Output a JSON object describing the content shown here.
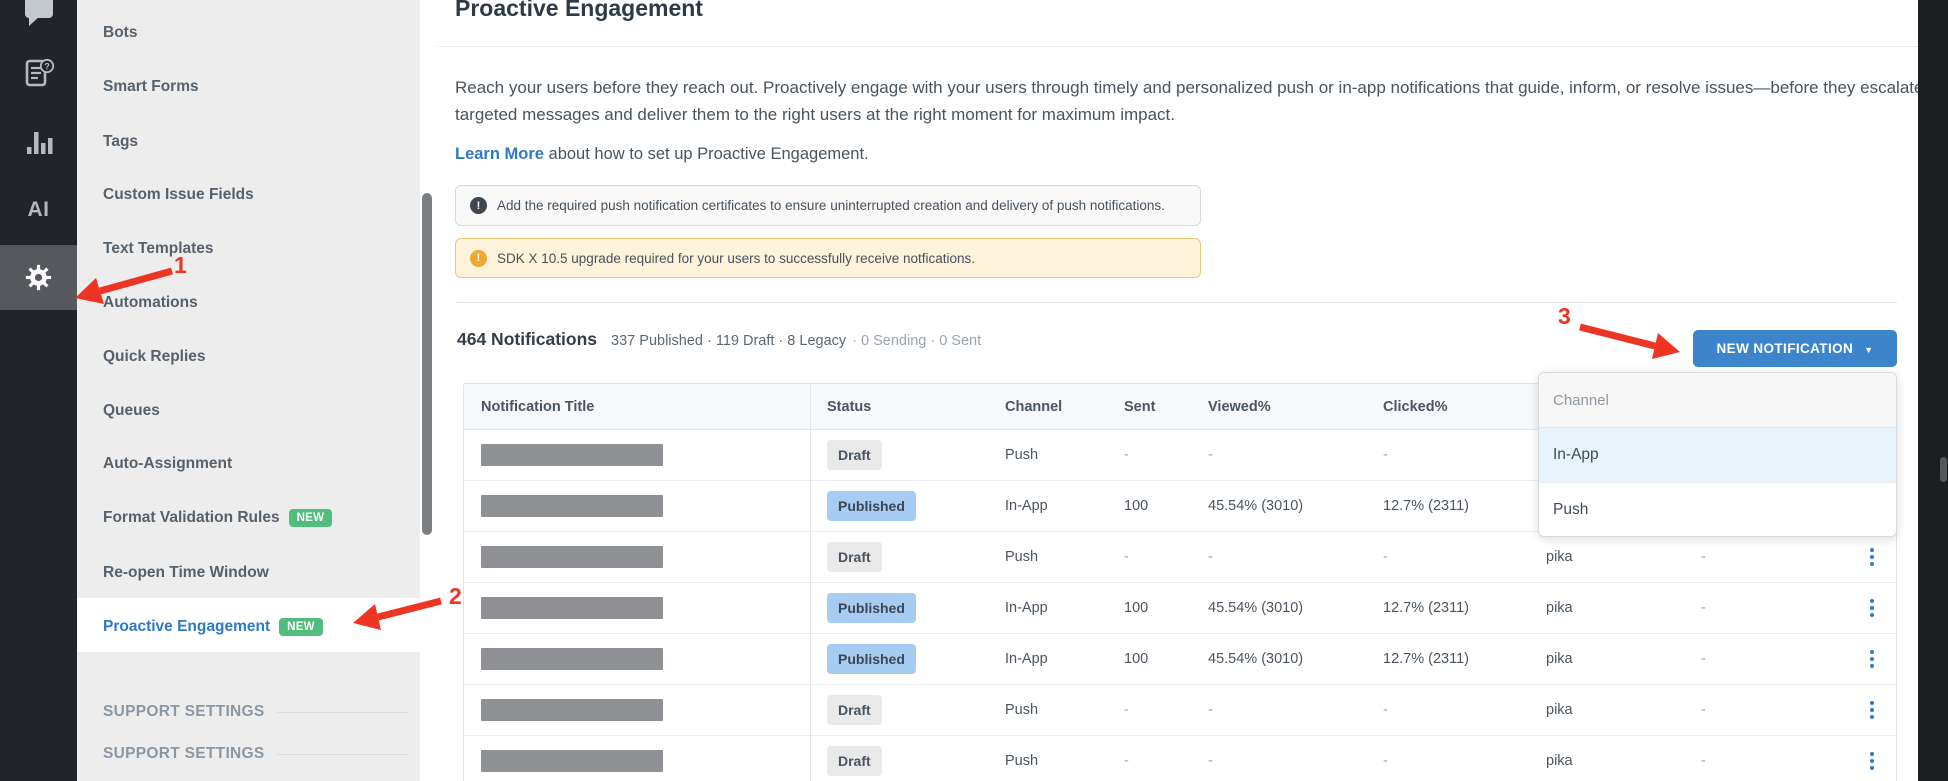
{
  "annotations": {
    "step1": "1",
    "step2": "2",
    "step3": "3"
  },
  "rail": {
    "ai_label": "AI",
    "icons": [
      "conversations-icon",
      "faq-article-icon",
      "analytics-icon",
      "ai-icon",
      "settings-gear-icon"
    ]
  },
  "sidebar": {
    "items": [
      {
        "label": "Bots"
      },
      {
        "label": "Smart Forms"
      },
      {
        "label": "Tags"
      },
      {
        "label": "Custom Issue Fields"
      },
      {
        "label": "Text Templates"
      },
      {
        "label": "Automations"
      },
      {
        "label": "Quick Replies"
      },
      {
        "label": "Queues"
      },
      {
        "label": "Auto-Assignment"
      },
      {
        "label": "Format Validation Rules",
        "badge": "NEW"
      },
      {
        "label": "Re-open Time Window"
      },
      {
        "label": "Proactive Engagement",
        "badge": "NEW",
        "active": true
      }
    ],
    "section_headers": [
      "SUPPORT SETTINGS",
      "SUPPORT SETTINGS"
    ]
  },
  "page": {
    "title": "Proactive Engagement",
    "description_line1": "Reach your users before they reach out. Proactively engage with your users through timely and personalized push or in-app notifications that guide, inform, or resolve issues—before they escalate. Craft",
    "description_line2": "targeted messages and deliver them to the right users at the right moment for maximum impact.",
    "learn_more_link": "Learn More",
    "learn_more_rest": " about how to set up Proactive Engagement."
  },
  "alerts": [
    {
      "type": "info",
      "icon_glyph": "!",
      "text": "Add the required push notification certificates to ensure uninterrupted creation and delivery of push notifications."
    },
    {
      "type": "warning",
      "icon_glyph": "!",
      "text": "SDK X 10.5 upgrade required for your users to successfully receive notfications."
    }
  ],
  "summary": {
    "count": "464 Notifications",
    "stats": "337 Published · 119 Draft · 8 Legacy",
    "stats_muted": "· 0 Sending · 0 Sent"
  },
  "toolbar": {
    "new_notification_label": "NEW NOTIFICATION",
    "caret": "▼"
  },
  "dropdown": {
    "header": "Channel",
    "options": [
      {
        "label": "In-App",
        "highlighted": true
      },
      {
        "label": "Push",
        "highlighted": false
      }
    ]
  },
  "table": {
    "columns": [
      "Notification Title",
      "Status",
      "Channel",
      "Sent",
      "Viewed%",
      "Clicked%"
    ],
    "rows": [
      {
        "status": "Draft",
        "channel": "Push",
        "sent": "-",
        "viewed": "-",
        "clicked": "-",
        "created_by": "",
        "col8": ""
      },
      {
        "status": "Published",
        "channel": "In-App",
        "sent": "100",
        "viewed": "45.54% (3010)",
        "clicked": "12.7% (2311)",
        "created_by": "",
        "col8": ""
      },
      {
        "status": "Draft",
        "channel": "Push",
        "sent": "-",
        "viewed": "-",
        "clicked": "-",
        "created_by": "pika",
        "col8": "-"
      },
      {
        "status": "Published",
        "channel": "In-App",
        "sent": "100",
        "viewed": "45.54% (3010)",
        "clicked": "12.7% (2311)",
        "created_by": "pika",
        "col8": "-"
      },
      {
        "status": "Published",
        "channel": "In-App",
        "sent": "100",
        "viewed": "45.54% (3010)",
        "clicked": "12.7% (2311)",
        "created_by": "pika",
        "col8": "-"
      },
      {
        "status": "Draft",
        "channel": "Push",
        "sent": "-",
        "viewed": "-",
        "clicked": "-",
        "created_by": "pika",
        "col8": "-"
      },
      {
        "status": "Draft",
        "channel": "Push",
        "sent": "-",
        "viewed": "-",
        "clicked": "-",
        "created_by": "pika",
        "col8": "-"
      }
    ]
  },
  "colors": {
    "accent_blue": "#3c85cc",
    "link_blue": "#2e7ac7",
    "badge_green": "#50bd7c",
    "published_badge_blue": "#a6ccf2",
    "draft_badge_gray": "#e9e9ea",
    "annotation_red": "#ee3524",
    "warning_bg": "#fcf3da",
    "warning_border": "#ecca7a",
    "rail_bg": "#212428",
    "sidebar_bg": "#ededee"
  }
}
